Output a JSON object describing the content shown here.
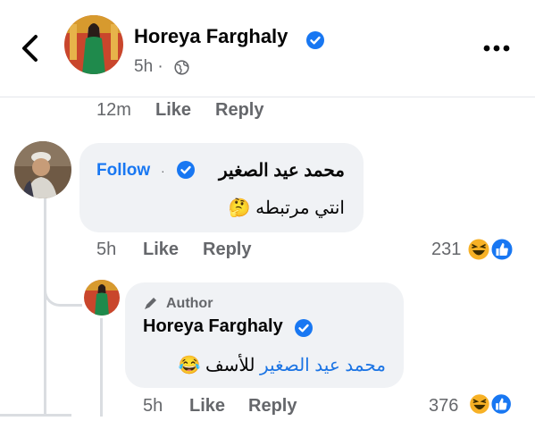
{
  "header": {
    "name": "Horeya Farghaly",
    "time": "5h",
    "separator": "·",
    "privacy_icon": "globe-icon",
    "back_icon": "chevron-left-icon",
    "more_icon": "more-horizontal-icon"
  },
  "previous_comment_actions": {
    "time": "12m",
    "like_label": "Like",
    "reply_label": "Reply"
  },
  "comment": {
    "author": "محمد عيد الصغير",
    "follow_label": "Follow",
    "separator": "·",
    "text": "انتي مرتبطه",
    "emoji": "🤔",
    "time": "5h",
    "like_label": "Like",
    "reply_label": "Reply",
    "reaction_count": "231",
    "reaction_icons": [
      "like-icon",
      "haha-icon"
    ]
  },
  "reply": {
    "author_label": "Author",
    "author": "Horeya Farghaly",
    "mention": "محمد عيد الصغير",
    "text": "للأسف",
    "emoji": "😂",
    "time": "5h",
    "like_label": "Like",
    "reply_label": "Reply",
    "reaction_count": "376",
    "reaction_icons": [
      "like-icon",
      "haha-icon"
    ]
  },
  "colors": {
    "brand_blue": "#1877f2",
    "secondary_text": "#65676b",
    "bubble_background": "#f0f2f5"
  }
}
